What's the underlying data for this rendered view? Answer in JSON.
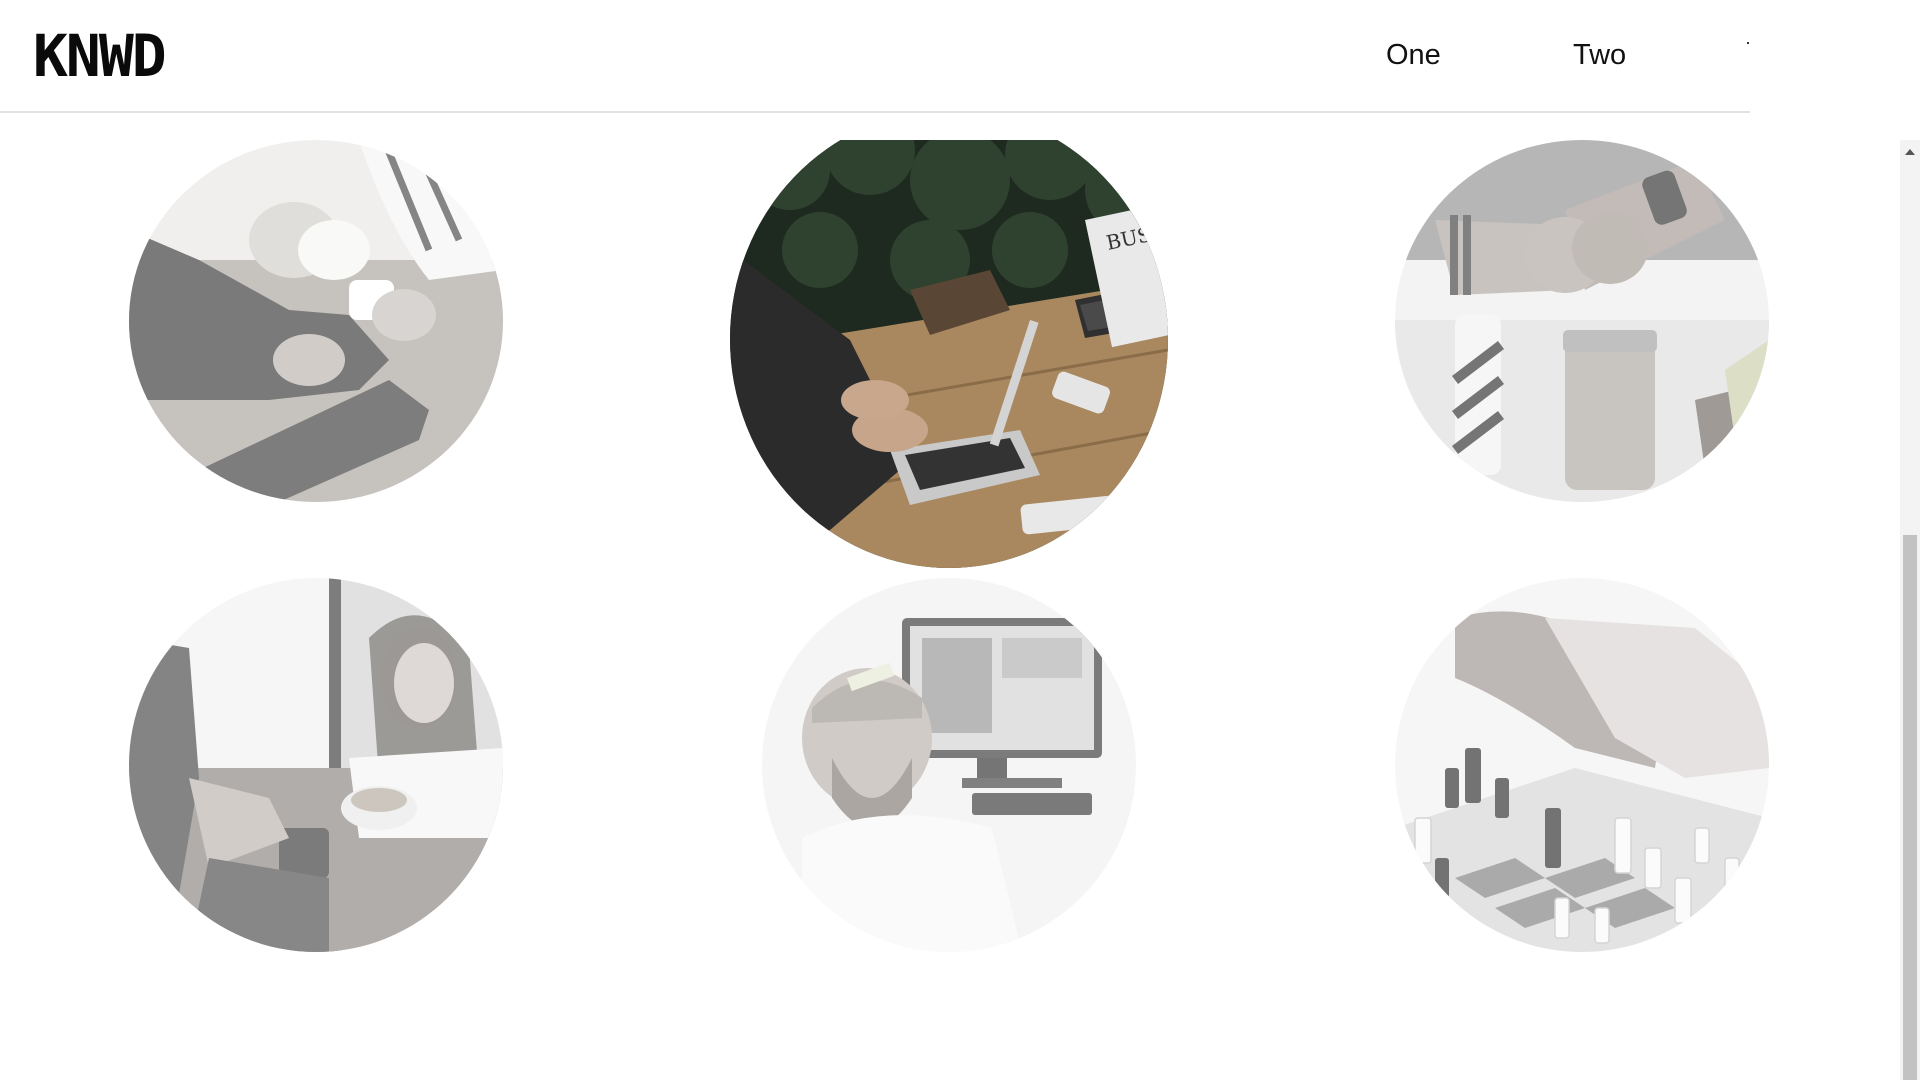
{
  "header": {
    "logo": "KNWD",
    "nav": [
      {
        "label": "One"
      },
      {
        "label": "Two"
      }
    ]
  },
  "gallery": {
    "items": [
      {
        "subject": "pouring-tea-photo"
      },
      {
        "subject": "laptop-meeting-photo"
      },
      {
        "subject": "fist-bump-photo"
      },
      {
        "subject": "cafe-conversation-photo"
      },
      {
        "subject": "smiling-man-desk-photo"
      },
      {
        "subject": "handshake-chess-photo"
      }
    ]
  },
  "colors": {
    "background": "#ffffff",
    "text": "#111111",
    "divider": "#e2e2e2"
  }
}
